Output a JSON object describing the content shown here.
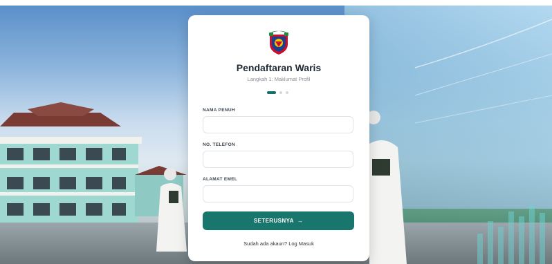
{
  "card": {
    "title": "Pendaftaran Waris",
    "subtitle": "Langkah 1: Maklumat Profil",
    "steps_total": 3,
    "current_step": 1
  },
  "form": {
    "name_label": "NAMA PENUH",
    "name_value": "",
    "phone_label": "NO. TELEFON",
    "phone_value": "",
    "email_label": "ALAMAT EMEL",
    "email_value": "",
    "next_button": "SETERUSNYA",
    "next_arrow": "→"
  },
  "footer": {
    "prompt": "Sudah ada akaun?",
    "login_link": "Log Masuk"
  },
  "colors": {
    "accent": "#18766c",
    "step_active": "#146f68",
    "step_inactive": "#d6d9dc"
  },
  "icons": {
    "logo": "school-crest-icon",
    "button": "arrow-right-icon"
  }
}
